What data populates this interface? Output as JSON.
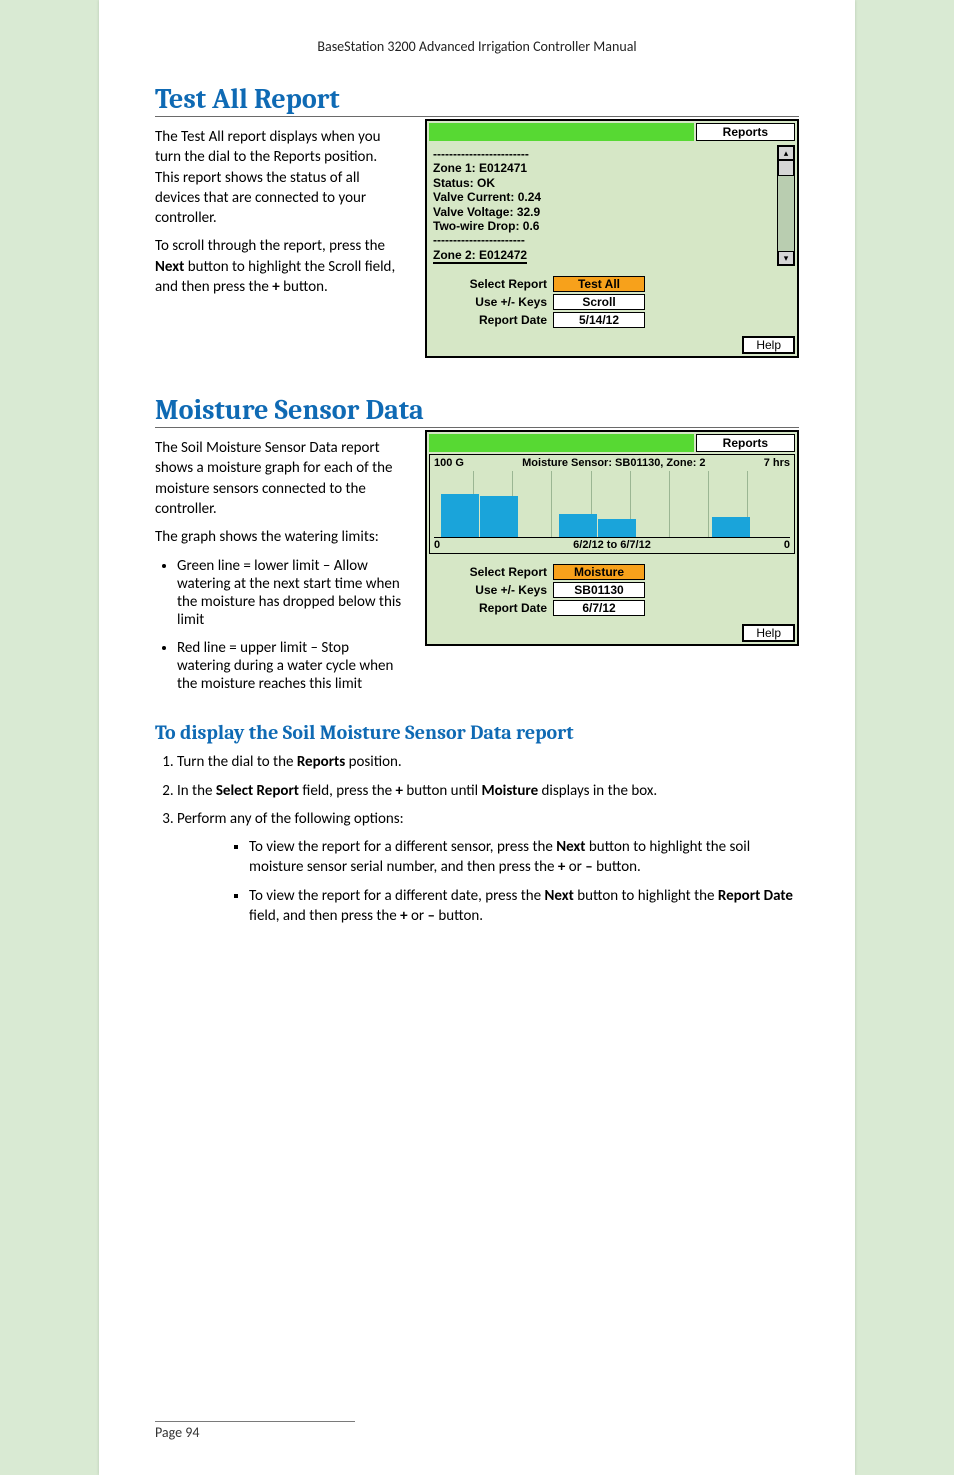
{
  "running_header": "BaseStation 3200 Advanced Irrigation Controller Manual",
  "section1": {
    "heading": "Test All Report",
    "p1_prefix": "The Test All report displays when you turn the dial to the Reports position. This report shows the status of all devices that are connected to your controller.",
    "p2_pre": "To scroll through the report, press the ",
    "p2_bold1": "Next",
    "p2_mid": " button to highlight the Scroll field, and then press the ",
    "p2_bold2": "+",
    "p2_post": " button."
  },
  "lcd1": {
    "title": "Reports",
    "lines": [
      "------------------------",
      "Zone 1: E012471",
      "Status: OK",
      "Valve Current: 0.24",
      "Valve Voltage: 32.9",
      "Two-wire Drop: 0.6",
      "-----------------------",
      "Zone 2: E012472"
    ],
    "select_label": "Select Report",
    "select_value": "Test All",
    "keys_label": "Use +/- Keys",
    "keys_value": "Scroll",
    "date_label": "Report Date",
    "date_value": "5/14/12",
    "help": "Help"
  },
  "section2": {
    "heading": "Moisture Sensor Data",
    "p1": "The Soil Moisture Sensor Data report shows a moisture graph for each of the moisture sensors connected to the controller.",
    "p2": "The graph shows the watering limits:",
    "bul1": "Green line = lower limit – Allow watering at the next start time when the moisture has dropped below this limit",
    "bul2": "Red line = upper limit – Stop watering during a water cycle when the moisture reaches this limit"
  },
  "lcd2": {
    "title": "Reports",
    "y_left": "100 G",
    "chart_title": "Moisture Sensor: SB01130, Zone: 2",
    "y_right": "7 hrs",
    "x_date": "6/2/12 to 6/7/12",
    "zero_left": "0",
    "zero_right": "0",
    "select_label": "Select Report",
    "select_value": "Moisture",
    "keys_label": "Use +/- Keys",
    "keys_value": "SB01130",
    "date_label": "Report Date",
    "date_value": "6/7/12",
    "help": "Help"
  },
  "chart_data": {
    "type": "bar",
    "title": "Moisture Sensor: SB01130, Zone: 2",
    "xlabel": "6/2/12 to 6/7/12",
    "ylabel": "",
    "ylim": [
      0,
      100
    ],
    "series": [
      {
        "name": "moisture",
        "values": [
          65,
          63,
          0,
          35,
          28,
          0,
          0,
          30,
          0
        ]
      }
    ]
  },
  "howto": {
    "heading": "To display the Soil Moisture Sensor Data report",
    "step1_pre": "Turn the dial to the ",
    "step1_b": "Reports",
    "step1_post": " position.",
    "step2_pre": "In the ",
    "step2_b1": "Select Report",
    "step2_mid1": " field, press the ",
    "step2_b2": "+",
    "step2_mid2": " button until ",
    "step2_b3": "Moisture",
    "step2_post": " displays in the box.",
    "step3": "Perform any of the following options:",
    "s3a_pre": "To view the report for a different sensor, press the ",
    "s3a_b1": "Next",
    "s3a_mid1": " button to highlight the soil moisture sensor serial number, and then press the ",
    "s3a_b2": "+",
    "s3a_mid2": " or ",
    "s3a_b3": "–",
    "s3a_post": " button.",
    "s3b_pre": "To view the report for a different date, press the ",
    "s3b_b1": "Next",
    "s3b_mid1": " button to highlight the ",
    "s3b_b2": "Report Date",
    "s3b_mid2": " field, and then press the ",
    "s3b_b3": "+",
    "s3b_mid3": " or ",
    "s3b_b4": "–",
    "s3b_post": " button."
  },
  "page_footer": "Page 94"
}
